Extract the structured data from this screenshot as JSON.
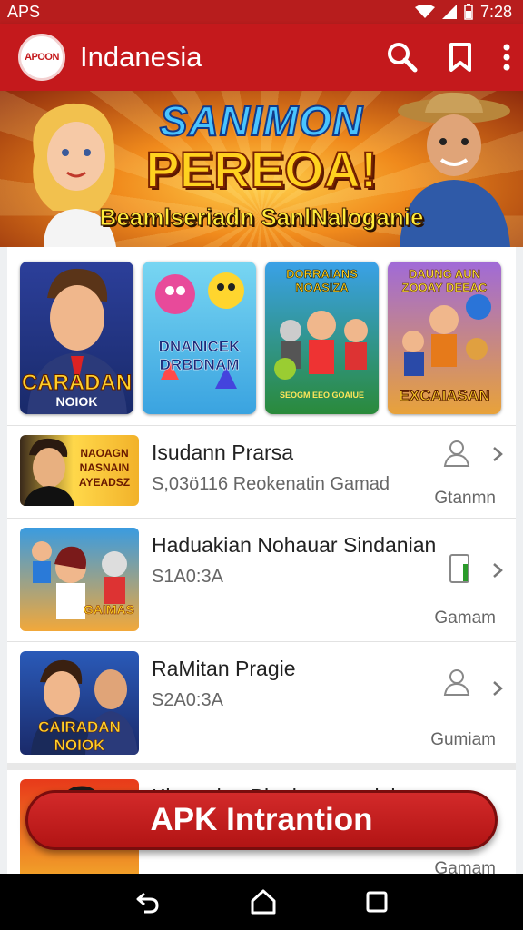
{
  "status_bar": {
    "carrier": "APS",
    "time": "7:28"
  },
  "app_bar": {
    "logo_text": "APOON",
    "title": "Indanesia"
  },
  "banner": {
    "line1": "SANIMON",
    "line2": "PEREOA!",
    "line3": "Beamlseriadn SanlNaloganie"
  },
  "featured": [
    {
      "label": "CARADAN",
      "sublabel": "NOIOK"
    },
    {
      "label": "DNANICEK DRBDNAM"
    },
    {
      "label": "DORRAIANS NOASIZA",
      "sublabel": "SEOGM EEO GOAIUE"
    },
    {
      "label": "DAUNG AUN ZOOAY DEEAC",
      "sublabel": "EXCAIASAN"
    }
  ],
  "list_items": [
    {
      "title": "Isudann Prarsa",
      "subtitle": "S,03ö116 Reokenatin Gamad",
      "category": "Gtanmn",
      "icon": "person-icon",
      "thumb_text": "NAOAGN NASNAIN AYEADSZ"
    },
    {
      "title": "Haduakian Nohauar Sindanian",
      "subtitle": "S1A0:3A",
      "category": "Gamam",
      "icon": "phone-battery-icon",
      "thumb_text": "GAIMAS"
    },
    {
      "title": "RaMitan Pragie",
      "subtitle": "S2A0:3A",
      "category": "Gumiam",
      "icon": "person-icon",
      "thumb_text": "CAIRADAN NOIOK"
    },
    {
      "title": "Kinnanian Blankssann slalunn",
      "subtitle": "",
      "category": "Gamam",
      "icon": "person-icon"
    }
  ],
  "fab": {
    "label": "APK Intrantion"
  },
  "colors": {
    "primary": "#c4191c",
    "status_bar": "#b71d1d"
  }
}
